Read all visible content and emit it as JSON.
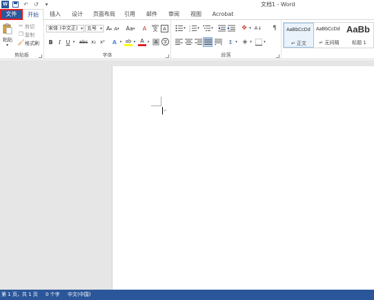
{
  "title_bar": {
    "doc_title": "文档1 - Word",
    "undo_glyph": "↶",
    "redo_glyph": "↺",
    "customize_glyph": "▾",
    "app_icon_letter": "W"
  },
  "tabs": [
    {
      "id": "file",
      "label": "文件"
    },
    {
      "id": "home",
      "label": "开始"
    },
    {
      "id": "insert",
      "label": "插入"
    },
    {
      "id": "design",
      "label": "设计"
    },
    {
      "id": "layout",
      "label": "页面布局"
    },
    {
      "id": "references",
      "label": "引用"
    },
    {
      "id": "mailings",
      "label": "邮件"
    },
    {
      "id": "review",
      "label": "审阅"
    },
    {
      "id": "view",
      "label": "视图"
    },
    {
      "id": "acrobat",
      "label": "Acrobat"
    }
  ],
  "ribbon": {
    "clipboard": {
      "label": "剪贴板",
      "paste": "粘贴",
      "cut": "剪切",
      "copy": "复制",
      "format_painter": "格式刷"
    },
    "font": {
      "label": "字体",
      "font_name": "宋体 (中文正)",
      "font_size": "五号",
      "bold": "B",
      "italic": "I",
      "underline": "U",
      "strikethrough": "abc",
      "subscript": "x₂",
      "superscript": "x²",
      "grow": "A",
      "shrink": "A",
      "change_case": "Aa",
      "clear_format": "A",
      "pinyin": "wén",
      "char_border": "A",
      "text_effects": "A",
      "highlight": "ab",
      "font_color": "A",
      "char_shading": "A",
      "enclose": "字"
    },
    "paragraph": {
      "label": "段落"
    },
    "styles": {
      "items": [
        {
          "sample": "AaBbCcDd",
          "name": "↵ 正文"
        },
        {
          "sample": "AaBbCcDd",
          "name": "↵ 无间隔"
        },
        {
          "sample": "AaBb",
          "name": "标题 1"
        }
      ]
    }
  },
  "status": {
    "page": "第 1 页，共 1 页",
    "words": "0 个字",
    "language": "中文(中国)"
  },
  "colors": {
    "brand_blue": "#2b579a",
    "file_tab_highlight": "#e31e24",
    "highlight_yellow": "#ffff00",
    "font_color_red": "#e31e24"
  }
}
